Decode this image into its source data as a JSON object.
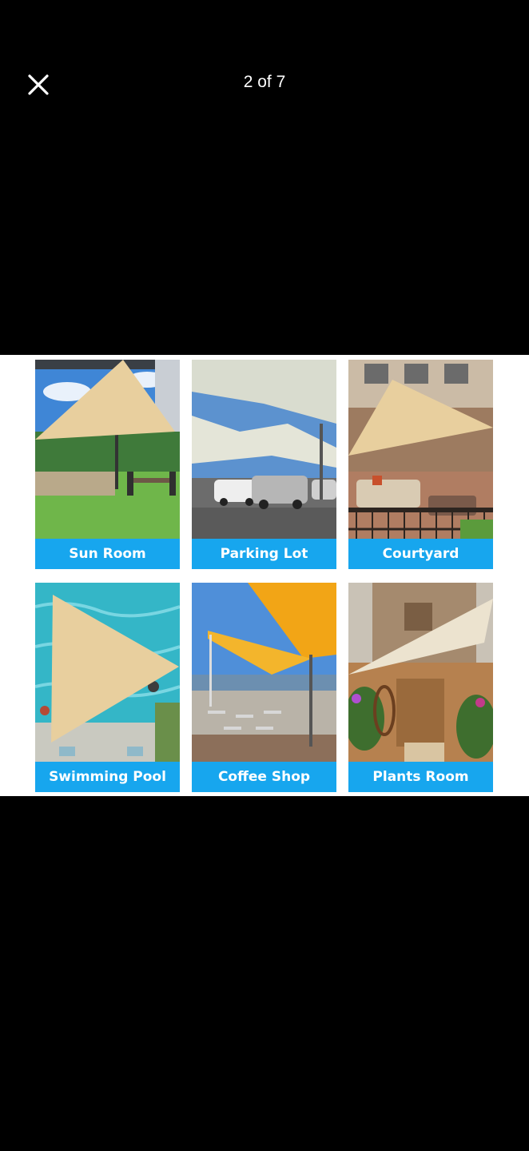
{
  "header": {
    "close_icon": "close-icon",
    "counter": "2 of 7"
  },
  "image": {
    "tiles": [
      {
        "label": "Sun Room"
      },
      {
        "label": "Parking Lot"
      },
      {
        "label": "Courtyard"
      },
      {
        "label": "Swimming Pool"
      },
      {
        "label": "Coffee Shop"
      },
      {
        "label": "Plants Room"
      }
    ],
    "label_color": "#17a6ee",
    "sail_color": "#e8cf9e"
  }
}
